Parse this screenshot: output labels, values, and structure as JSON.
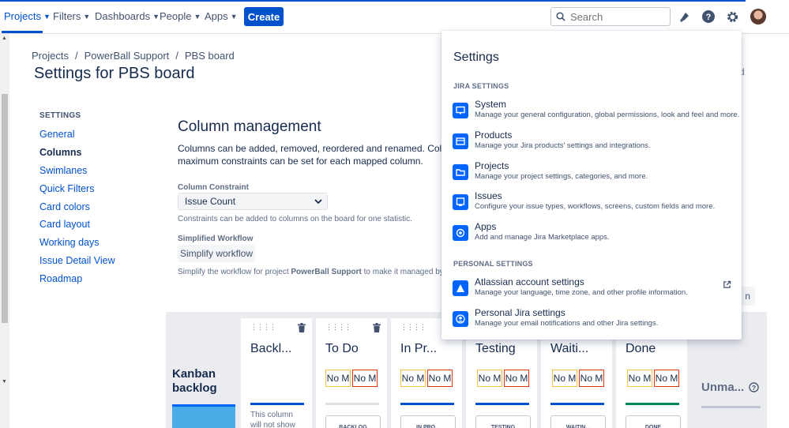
{
  "nav": {
    "items": [
      {
        "label": "Projects",
        "active": true
      },
      {
        "label": "Filters"
      },
      {
        "label": "Dashboards"
      },
      {
        "label": "People"
      },
      {
        "label": "Apps"
      }
    ],
    "create_label": "Create",
    "search_placeholder": "Search"
  },
  "breadcrumbs": [
    "Projects",
    "PowerBall Support",
    "PBS board"
  ],
  "page_title": "Settings for PBS board",
  "board_label_partial": "rd",
  "sidebar": {
    "heading": "SETTINGS",
    "items": [
      {
        "label": "General"
      },
      {
        "label": "Columns",
        "active": true
      },
      {
        "label": "Swimlanes"
      },
      {
        "label": "Quick Filters"
      },
      {
        "label": "Card colors"
      },
      {
        "label": "Card layout"
      },
      {
        "label": "Working days"
      },
      {
        "label": "Issue Detail View"
      },
      {
        "label": "Roadmap"
      }
    ]
  },
  "column_management": {
    "title": "Column management",
    "desc_line1": "Columns can be added, removed, reordered and renamed. Columns are",
    "desc_line2": "maximum constraints can be set for each mapped column.",
    "constraint_label": "Column Constraint",
    "constraint_value": "Issue Count",
    "constraint_hint": "Constraints can be added to columns on the board for one statistic.",
    "workflow_label": "Simplified Workflow",
    "simplify_button": "Simplify workflow",
    "workflow_hint_pre": "Simplify the workflow for project ",
    "workflow_hint_project": "PowerBall Support",
    "workflow_hint_post": " to make it managed by Jira S",
    "add_column_partial": "n"
  },
  "board": {
    "kanban_backlog": "Kanban backlog",
    "columns": [
      {
        "name": "Backl...",
        "note": "This column will not show on the",
        "bar_color": "#0052cc"
      },
      {
        "name": "To Do",
        "min": "No M",
        "max": "No M",
        "bar_color": "#dfe1e6",
        "status": "BACKLOG"
      },
      {
        "name": "In Pr...",
        "min": "No M",
        "max": "No M",
        "bar_color": "#0052cc",
        "status": "IN PRO..."
      },
      {
        "name": "Testing",
        "min": "No M",
        "max": "No M",
        "bar_color": "#0052cc",
        "status": "TESTING"
      },
      {
        "name": "Waiti...",
        "min": "No M",
        "max": "No M",
        "bar_color": "#0052cc",
        "status": "WAITIN..."
      },
      {
        "name": "Done",
        "min": "No M",
        "max": "No M",
        "bar_color": "#00875a",
        "status": "DONE"
      }
    ],
    "unmapped": "Unma..."
  },
  "settings_menu": {
    "title": "Settings",
    "jira_section": "JIRA SETTINGS",
    "jira_items": [
      {
        "name": "System",
        "desc": "Manage your general configuration, global permissions, look and feel and more.",
        "icon": "monitor-icon"
      },
      {
        "name": "Products",
        "desc": "Manage your Jira products' settings and integrations.",
        "icon": "products-icon"
      },
      {
        "name": "Projects",
        "desc": "Manage your project settings, categories, and more.",
        "icon": "folder-icon"
      },
      {
        "name": "Issues",
        "desc": "Configure your issue types, workflows, screens, custom fields and more.",
        "icon": "issues-icon"
      },
      {
        "name": "Apps",
        "desc": "Add and manage Jira Marketplace apps.",
        "icon": "apps-icon"
      }
    ],
    "personal_section": "PERSONAL SETTINGS",
    "personal_items": [
      {
        "name": "Atlassian account settings",
        "desc": "Manage your language, time zone, and other profile information.",
        "icon": "atlassian-icon"
      },
      {
        "name": "Personal Jira settings",
        "desc": "Manage your email notifications and other Jira settings.",
        "icon": "person-icon"
      }
    ]
  },
  "colors": {
    "brand": "#0052cc",
    "text": "#172b4d",
    "subtle": "#5e6c84"
  }
}
